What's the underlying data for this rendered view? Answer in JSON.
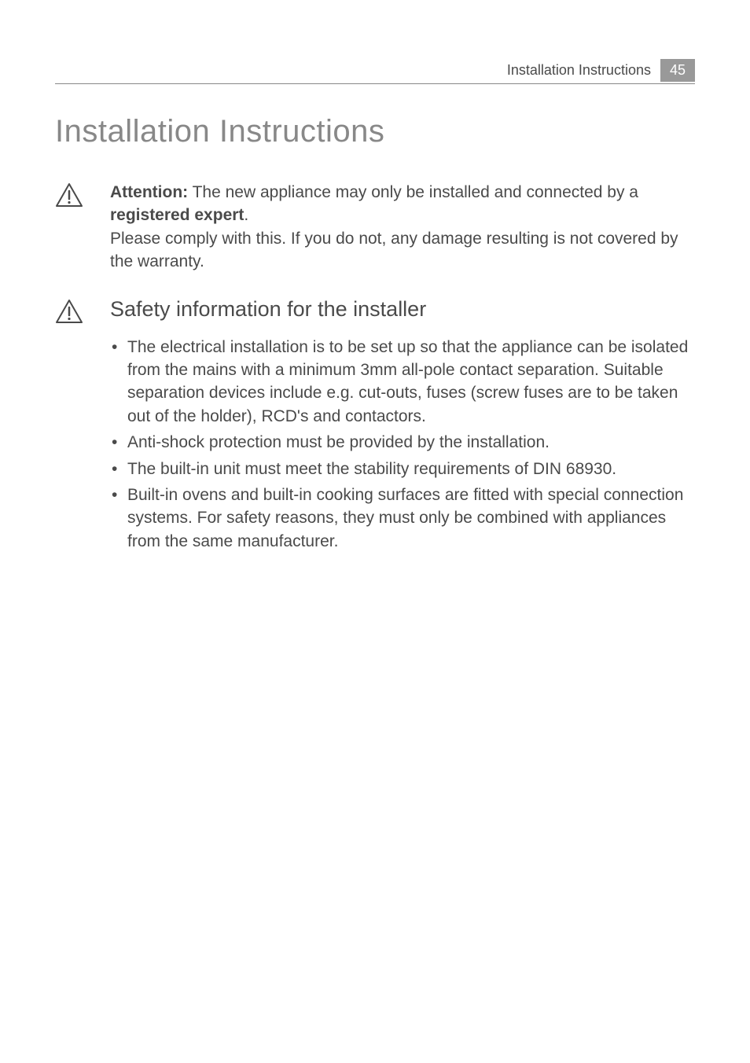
{
  "header": {
    "section_title": "Installation Instructions",
    "page_number": "45"
  },
  "main_title": "Installation Instructions",
  "attention": {
    "label": "Attention:",
    "text_part1": " The new appliance may only be installed and connected by a ",
    "bold_phrase": "registered expert",
    "text_part2": ".",
    "followup": "Please comply with this. If you do not, any damage resulting is not covered by the warranty."
  },
  "safety_section": {
    "heading": "Safety information for the installer",
    "bullets": [
      "The electrical installation is to be set up so that the appliance can be isolated from the mains with a minimum 3mm all-pole contact separation. Suitable separation devices include e.g. cut-outs, fuses (screw fuses are to be taken out of the holder), RCD's and contactors.",
      "Anti-shock protection must be provided by the installation.",
      "The built-in unit must meet the stability requirements of DIN 68930.",
      "Built-in ovens and built-in cooking surfaces are fitted with special connection systems. For safety reasons, they must only be combined with appliances from the same manufacturer."
    ]
  }
}
